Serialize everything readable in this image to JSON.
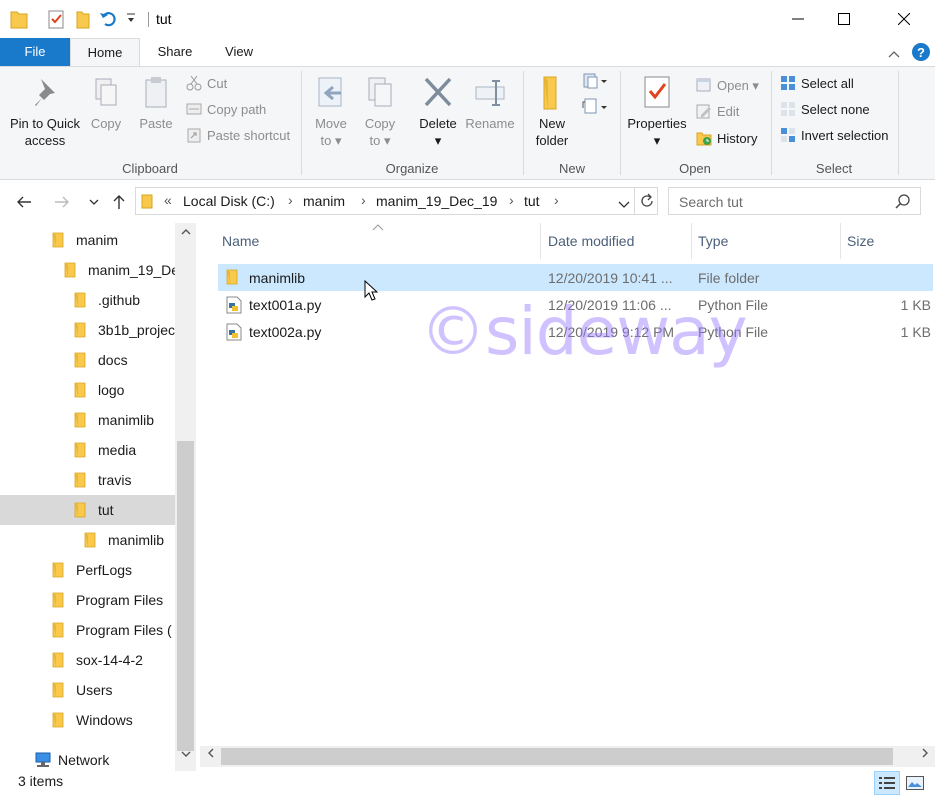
{
  "window": {
    "title": "tut",
    "buttons": [
      "minimize",
      "maximize",
      "close"
    ]
  },
  "ribbon_tabs": {
    "file": "File",
    "home": "Home",
    "share": "Share",
    "view": "View"
  },
  "ribbon": {
    "clipboard": {
      "label": "Clipboard",
      "pin": [
        "Pin to Quick",
        "access"
      ],
      "copy": "Copy",
      "paste": "Paste",
      "cut": "Cut",
      "copy_path": "Copy path",
      "paste_shortcut": "Paste shortcut"
    },
    "organize": {
      "label": "Organize",
      "move_to": [
        "Move",
        "to"
      ],
      "copy_to": [
        "Copy",
        "to"
      ],
      "delete": "Delete",
      "rename": "Rename"
    },
    "new": {
      "label": "New",
      "new_folder": [
        "New",
        "folder"
      ]
    },
    "open": {
      "label": "Open",
      "properties": "Properties",
      "open": "Open",
      "edit": "Edit",
      "history": "History"
    },
    "select": {
      "label": "Select",
      "select_all": "Select all",
      "select_none": "Select none",
      "invert_selection": "Invert selection"
    }
  },
  "address": {
    "prefix": "«",
    "crumbs": [
      "Local Disk (C:)",
      "manim",
      "manim_19_Dec_19",
      "tut"
    ],
    "search_placeholder": "Search tut"
  },
  "nav_tree": [
    {
      "label": "manim",
      "level": 0
    },
    {
      "label": "manim_19_De",
      "level": 1
    },
    {
      "label": ".github",
      "level": 2
    },
    {
      "label": "3b1b_projec",
      "level": 2
    },
    {
      "label": "docs",
      "level": 2
    },
    {
      "label": "logo",
      "level": 2
    },
    {
      "label": "manimlib",
      "level": 2
    },
    {
      "label": "media",
      "level": 2
    },
    {
      "label": "travis",
      "level": 2
    },
    {
      "label": "tut",
      "level": 2,
      "selected": true
    },
    {
      "label": "manimlib",
      "level": 3
    },
    {
      "label": "PerfLogs",
      "level": 0
    },
    {
      "label": "Program Files",
      "level": 0
    },
    {
      "label": "Program Files (",
      "level": 0
    },
    {
      "label": "sox-14-4-2",
      "level": 0
    },
    {
      "label": "Users",
      "level": 0
    },
    {
      "label": "Windows",
      "level": 0
    },
    {
      "label": "Network",
      "level": -1
    }
  ],
  "columns": {
    "name": "Name",
    "date": "Date modified",
    "type": "Type",
    "size": "Size"
  },
  "files": [
    {
      "name": "manimlib",
      "date": "12/20/2019 10:41 ...",
      "type": "File folder",
      "size": "",
      "icon": "folder-icon",
      "selected": true
    },
    {
      "name": "text001a.py",
      "date": "12/20/2019 11:06 ...",
      "type": "Python File",
      "size": "1 KB",
      "icon": "python-file-icon"
    },
    {
      "name": "text002a.py",
      "date": "12/20/2019 9:12 PM",
      "type": "Python File",
      "size": "1 KB",
      "icon": "python-file-icon"
    }
  ],
  "watermark": "©sideway",
  "status": {
    "items": "3 items"
  },
  "colors": {
    "file_tab": "#1979ca",
    "selection": "#cce8ff",
    "nav_selected": "#d9d9d9",
    "folder": "#f8c94d",
    "watermark": "#9678ff"
  }
}
